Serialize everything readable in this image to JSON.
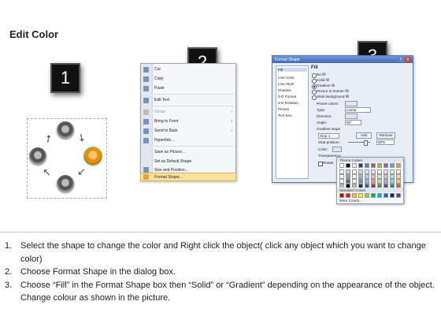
{
  "page": {
    "title": "Edit Color"
  },
  "steps": {
    "one": "1",
    "two": "2",
    "three": "3"
  },
  "context_menu": {
    "items": [
      {
        "label": "Cut",
        "underline": "t"
      },
      {
        "label": "Copy"
      },
      {
        "label": "Paste"
      },
      {
        "label": "Edit Text"
      },
      {
        "label": "Group",
        "disabled": true,
        "submenu": true
      },
      {
        "label": "Bring to Front",
        "submenu": true
      },
      {
        "label": "Send to Back",
        "submenu": true
      },
      {
        "label": "Hyperlink..."
      },
      {
        "label": "Save as Picture..."
      },
      {
        "label": "Set as Default Shape"
      },
      {
        "label": "Size and Position..."
      },
      {
        "label": "Format Shape...",
        "highlighted": true
      }
    ],
    "submenu_arrow": "›"
  },
  "format_dialog": {
    "title": "Format Shape",
    "title_buttons": {
      "help": "?",
      "close": "X"
    },
    "nav": [
      "Fill",
      "Line Color",
      "Line Style",
      "Shadow",
      "3-D Format",
      "3-D Rotation",
      "Picture",
      "Text Box"
    ],
    "nav_selected": "Fill",
    "section_title": "Fill",
    "fill_options": [
      "No fill",
      "Solid fill",
      "Gradient fill",
      "Picture or texture fill",
      "Slide background fill"
    ],
    "fill_selected": "Gradient fill",
    "labels": {
      "preset_colors": "Preset colors:",
      "type": "Type:",
      "type_value": "Linear",
      "direction": "Direction:",
      "angle": "Angle:",
      "angle_value": "90°",
      "gradient_stops": "Gradient stops",
      "stop_value": "Stop 1",
      "add": "Add",
      "remove": "Remove",
      "stop_position": "Stop position:",
      "stop_position_value": "80%",
      "color": "Color:",
      "transparency": "Transparency:",
      "rotate": "Rotate"
    },
    "palette": {
      "theme_header": "Theme Colors",
      "standard_header": "Standard Colors",
      "more": "More Colors...",
      "theme_top": [
        "#ffffff",
        "#000000",
        "#eeece1",
        "#1f497d",
        "#4f81bd",
        "#c0504d",
        "#9bbb59",
        "#8064a2",
        "#4bacc6",
        "#f79646"
      ],
      "standard": [
        "#c00000",
        "#ff0000",
        "#ffc000",
        "#ffff00",
        "#92d050",
        "#00b050",
        "#00b0f0",
        "#0070c0",
        "#002060",
        "#7030a0"
      ]
    }
  },
  "instructions": [
    {
      "num": "1.",
      "text": "Select the shape to change the color and Right click the object( click any object which you want to change color)"
    },
    {
      "num": "2.",
      "text": "Choose Format Shape in the dialog box."
    },
    {
      "num": "3.",
      "text": "Choose “Fill” in the Format Shape box then “Solid” or “Gradient” depending on the appearance of the object. Change colour as shown in the picture."
    }
  ],
  "colors": {
    "highlight": "#fbe2a0",
    "accent_orange": "#f08a00",
    "dialog_title": "#3f69b5"
  }
}
